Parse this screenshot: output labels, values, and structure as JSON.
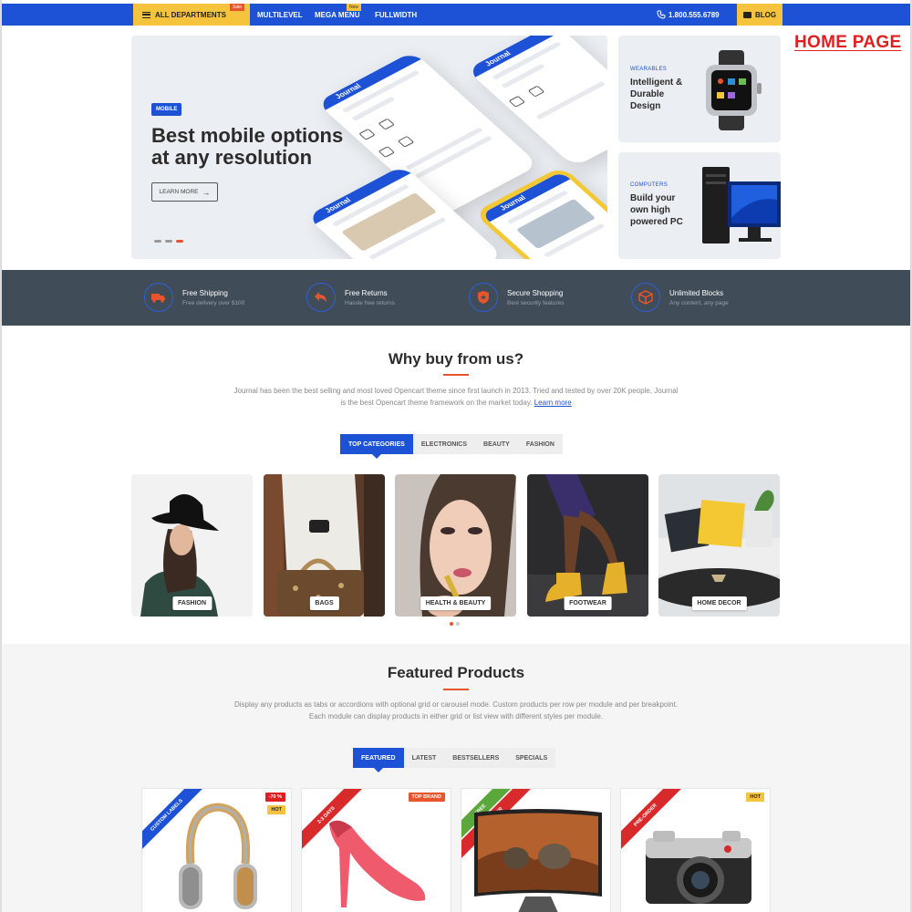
{
  "topbar": {
    "departments_label": "ALL DEPARTMENTS",
    "sale_badge": "Sale",
    "nav": [
      "MULTILEVEL",
      "MEGA MENU",
      "FULLWIDTH"
    ],
    "new_badge": "New",
    "phone": "1.800.555.6789",
    "blog_label": "BLOG"
  },
  "page_label": "HOME PAGE",
  "hero": {
    "tag": "MOBILE",
    "title_line1": "Best mobile options",
    "title_line2": "at any resolution",
    "button": "LEARN MORE",
    "phone_logo": "Journal"
  },
  "side_banners": [
    {
      "category": "WEARABLES",
      "text": "Intelligent & Durable Design",
      "icon": "smartwatch-icon"
    },
    {
      "category": "COMPUTERS",
      "text": "Build your own high powered PC",
      "icon": "desktop-pc-icon"
    }
  ],
  "features": [
    {
      "title": "Free Shipping",
      "subtitle": "Free delivery over $100",
      "icon": "truck-icon"
    },
    {
      "title": "Free Returns",
      "subtitle": "Hassle free returns",
      "icon": "return-arrow-icon"
    },
    {
      "title": "Secure Shopping",
      "subtitle": "Best security features",
      "icon": "shield-icon"
    },
    {
      "title": "Unlimited Blocks",
      "subtitle": "Any content, any page",
      "icon": "cube-icon"
    }
  ],
  "why": {
    "title": "Why buy from us?",
    "desc_line1": "Journal has been the best selling and most loved Opencart theme since first launch in 2013. Tried and tested by over 20K people, Journal",
    "desc_line2": "is the best Opencart theme framework on the market today.",
    "link": "Learn more"
  },
  "category_tabs": [
    "TOP CATEGORIES",
    "ELECTRONICS",
    "BEAUTY",
    "FASHION"
  ],
  "categories": [
    "FASHION",
    "BAGS",
    "HEALTH & BEAUTY",
    "FOOTWEAR",
    "HOME DECOR"
  ],
  "featured": {
    "title": "Featured Products",
    "desc_line1": "Display any products as tabs or accordions with optional grid or carousel mode. Custom products per row per module and per breakpoint.",
    "desc_line2": "Each module can display products in either grid or list view with different styles per module."
  },
  "product_tabs": [
    "FEATURED",
    "LATEST",
    "BESTSELLERS",
    "SPECIALS"
  ],
  "products": [
    {
      "ribbon": "CUSTOM LABELS",
      "ribbon2": "",
      "badges": [
        "-70 %",
        "HOT"
      ],
      "icon": "headphones-icon"
    },
    {
      "ribbon": "2-3 DAYS",
      "ribbon2": "",
      "badges": [
        "TOP BRAND"
      ],
      "icon": "high-heel-shoe-icon"
    },
    {
      "ribbon": "FREE",
      "ribbon2": "PRE-ORDER",
      "badges": [],
      "icon": "curved-tv-icon"
    },
    {
      "ribbon": "PRE-ORDER",
      "ribbon2": "",
      "badges": [
        "HOT"
      ],
      "icon": "camera-icon"
    }
  ],
  "colors": {
    "primary": "#1d52d6",
    "accent": "#f6c33c",
    "orange": "#e8552c",
    "dark": "#414c59"
  }
}
